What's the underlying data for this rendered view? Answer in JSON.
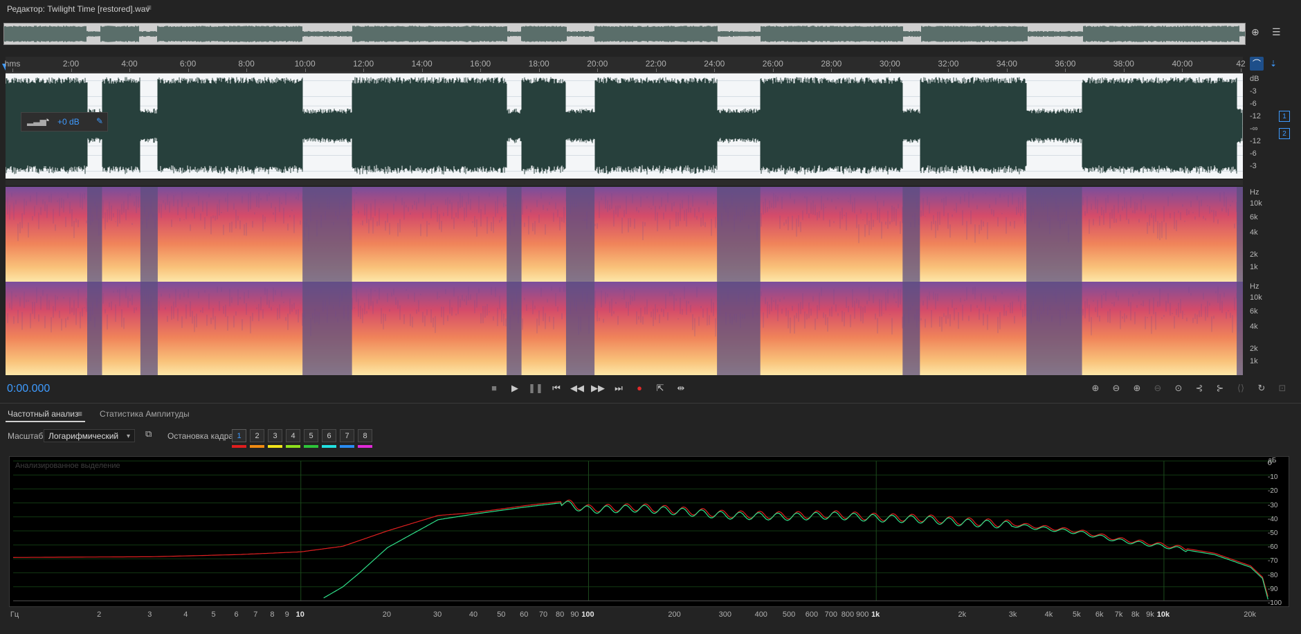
{
  "window": {
    "title": "Редактор: Twilight Time [restored].wav",
    "menu_glyph": "≡"
  },
  "ruler": {
    "labels": [
      "hms",
      "2:00",
      "4:00",
      "6:00",
      "8:00",
      "10:00",
      "12:00",
      "14:00",
      "16:00",
      "18:00",
      "20:00",
      "22:00",
      "24:00",
      "26:00",
      "28:00",
      "30:00",
      "32:00",
      "34:00",
      "36:00",
      "38:00",
      "40:00",
      "42"
    ]
  },
  "waveform": {
    "db_scale": [
      "dB",
      "-3",
      "-6",
      "-12",
      "-∞",
      "-12",
      "-6",
      "-3"
    ],
    "hud_gain": "+0 dB",
    "channels": [
      "1",
      "2"
    ]
  },
  "spectrogram": {
    "scale": [
      "Hz",
      "10k",
      "6k",
      "4k",
      "2k",
      "1k"
    ]
  },
  "transport": {
    "time": "0:00.000"
  },
  "panel": {
    "tabs": [
      "Частотный анализ",
      "Статистика Амплитуды"
    ],
    "active_tab": 0,
    "scale_label": "Масштаб:",
    "scale_value": "Логарифмический",
    "hold_label": "Остановка кадра:",
    "hold_buttons": [
      "1",
      "2",
      "3",
      "4",
      "5",
      "6",
      "7",
      "8"
    ],
    "hold_colors": [
      "#e01e1e",
      "#f08a12",
      "#f2e51a",
      "#8ee01c",
      "#2ec43a",
      "#22e0e0",
      "#2a8cf2",
      "#e02ad8"
    ],
    "caption": "Анализированное выделение"
  },
  "freq_chart": {
    "db_unit": "дБ",
    "db_ticks": [
      "0",
      "-10",
      "-20",
      "-30",
      "-40",
      "-50",
      "-60",
      "-70",
      "-80",
      "-90",
      "-100"
    ],
    "x_unit": "Гц",
    "x_ticks": [
      "2",
      "3",
      "4",
      "5",
      "6",
      "7",
      "8",
      "9",
      "10",
      "20",
      "30",
      "40",
      "50",
      "60",
      "70",
      "80",
      "90",
      "100",
      "200",
      "300",
      "400",
      "500",
      "600",
      "700",
      "800",
      "900",
      "1k",
      "2k",
      "3k",
      "4k",
      "5k",
      "6k",
      "7k",
      "8k",
      "9k",
      "10k",
      "20k"
    ]
  },
  "chart_data": {
    "type": "line",
    "xlabel": "Гц",
    "ylabel": "дБ",
    "x_scale": "log",
    "xlim": [
      1,
      24000
    ],
    "ylim": [
      -100,
      0
    ],
    "grid": true,
    "series": [
      {
        "color": "#e02020",
        "x": [
          1,
          3,
          6,
          10,
          14,
          20,
          30,
          40,
          60,
          80,
          100,
          150,
          200,
          300,
          500,
          700,
          1000,
          1500,
          2000,
          3000,
          5000,
          7000,
          10000,
          15000,
          20000,
          22000,
          23000
        ],
        "y": [
          -69,
          -68.5,
          -67,
          -65,
          -61,
          -50,
          -39,
          -37,
          -32,
          -29,
          -34,
          -33,
          -35,
          -38,
          -39,
          -38,
          -40,
          -41,
          -43,
          -45,
          -50,
          -56,
          -60,
          -66,
          -75,
          -83,
          -97
        ]
      },
      {
        "color": "#2fe08a",
        "x": [
          12,
          14,
          16,
          20,
          30,
          40,
          60,
          80,
          100,
          150,
          200,
          300,
          500,
          700,
          1000,
          1500,
          2000,
          3000,
          5000,
          7000,
          10000,
          15000,
          20000,
          22000,
          23000
        ],
        "y": [
          -98,
          -90,
          -80,
          -62,
          -42,
          -38,
          -33,
          -30,
          -35,
          -34,
          -36,
          -39,
          -40,
          -39,
          -41,
          -42,
          -44,
          -46,
          -51,
          -57,
          -61,
          -67,
          -76,
          -84,
          -99
        ]
      }
    ]
  }
}
